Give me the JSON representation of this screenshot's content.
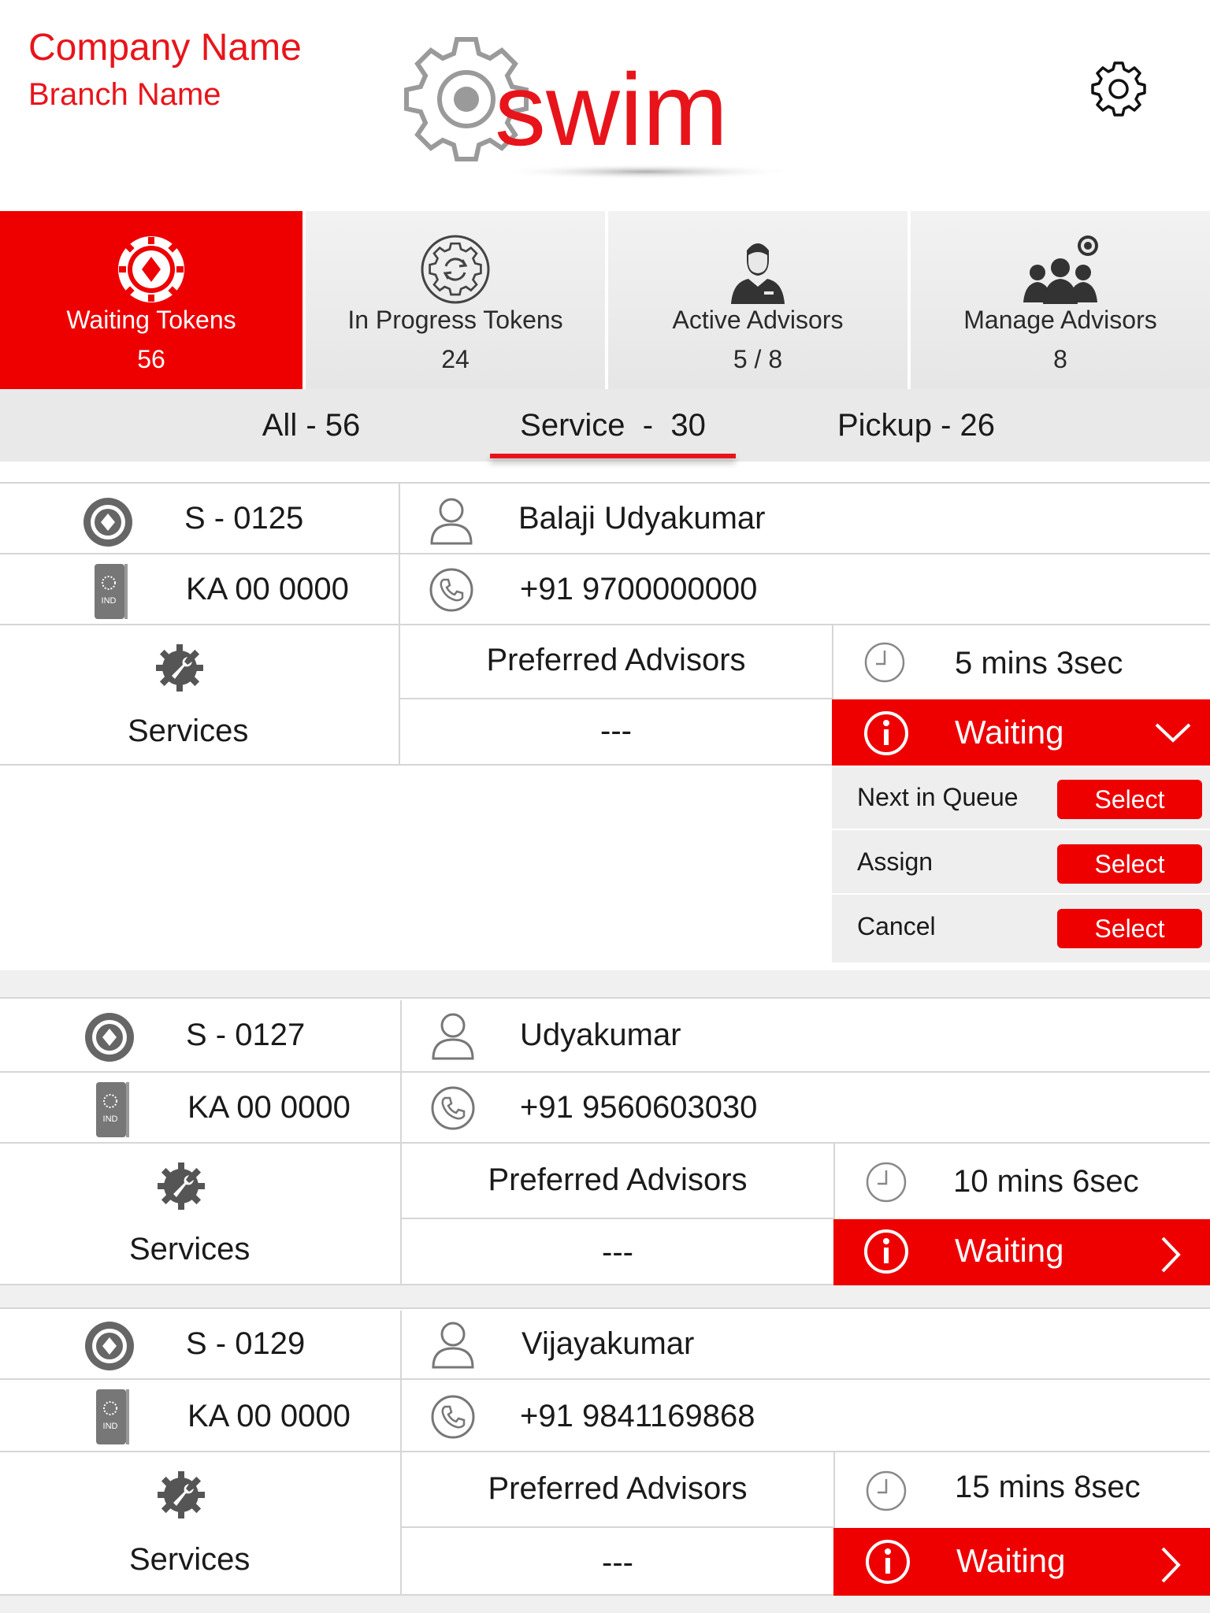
{
  "header": {
    "company_name": "Company Name",
    "branch_name": "Branch Name",
    "logo_text": "swim"
  },
  "colors": {
    "accent": "#ee0000",
    "logo_red": "#e8141b",
    "icon_gray": "#555555"
  },
  "top_tabs": [
    {
      "label": "Waiting Tokens",
      "count": "56",
      "icon": "token-chip-icon",
      "active": true
    },
    {
      "label": "In Progress Tokens",
      "count": "24",
      "icon": "gear-refresh-icon",
      "active": false
    },
    {
      "label": "Active Advisors",
      "count": "5 / 8",
      "icon": "advisor-person-icon",
      "active": false
    },
    {
      "label": "Manage Advisors",
      "count": "8",
      "icon": "group-gear-icon",
      "active": false
    }
  ],
  "filters": [
    {
      "label": "All - 56",
      "active": false
    },
    {
      "label": "Service  -  30",
      "active": true
    },
    {
      "label": "Pickup - 26",
      "active": false
    }
  ],
  "tokens": [
    {
      "token": "S - 0125",
      "customer": "Balaji Udyakumar",
      "plate": "KA 00 0000",
      "plate_region": "IND",
      "phone": "+91 9700000000",
      "services_label": "Services",
      "preferred_label": "Preferred Advisors",
      "preferred_value": "---",
      "wait_time": "5 mins 3sec",
      "status": "Waiting",
      "expanded": true
    },
    {
      "token": "S - 0127",
      "customer": "Udyakumar",
      "plate": "KA 00 0000",
      "plate_region": "IND",
      "phone": "+91 9560603030",
      "services_label": "Services",
      "preferred_label": "Preferred Advisors",
      "preferred_value": "---",
      "wait_time": "10 mins 6sec",
      "status": "Waiting",
      "expanded": false
    },
    {
      "token": "S - 0129",
      "customer": "Vijayakumar",
      "plate": "KA 00 0000",
      "plate_region": "IND",
      "phone": "+91 9841169868",
      "services_label": "Services",
      "preferred_label": "Preferred Advisors",
      "preferred_value": "---",
      "wait_time": "15 mins 8sec",
      "status": "Waiting",
      "expanded": false
    }
  ],
  "status_actions": [
    {
      "label": "Next in Queue",
      "button": "Select"
    },
    {
      "label": "Assign",
      "button": "Select"
    },
    {
      "label": "Cancel",
      "button": "Select"
    }
  ]
}
